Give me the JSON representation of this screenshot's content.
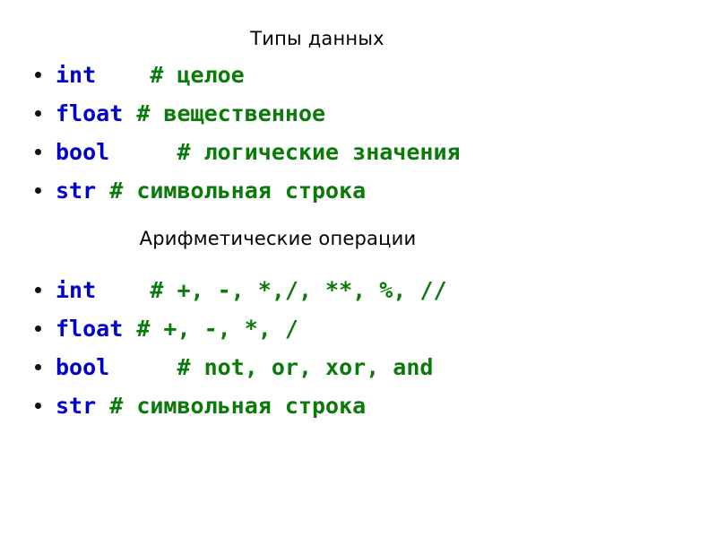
{
  "slide": {
    "background_color": "#ffffff",
    "keyword_color": "#0000cc",
    "comment_color": "#0a7a0a",
    "heading_color": "#000000",
    "bullet_color": "#111111"
  },
  "sections": [
    {
      "heading": "Типы данных",
      "items": [
        {
          "name": "int",
          "gap": "    ",
          "comment": "# целое"
        },
        {
          "name": "float",
          "gap": " ",
          "comment": "# вещественное"
        },
        {
          "name": "bool",
          "gap": "     ",
          "comment": "# логические значения"
        },
        {
          "name": "str",
          "gap": " ",
          "comment": "# символьная строка"
        }
      ]
    },
    {
      "heading": "Арифметические операции",
      "items": [
        {
          "name": "int",
          "gap": "    ",
          "comment": "# +, -, *,/, **, %, //"
        },
        {
          "name": "float",
          "gap": " ",
          "comment": "# +, -, *, /"
        },
        {
          "name": "bool",
          "gap": "     ",
          "comment": "# not, or, xor, and"
        },
        {
          "name": "str",
          "gap": " ",
          "comment": "# символьная строка"
        }
      ]
    }
  ]
}
